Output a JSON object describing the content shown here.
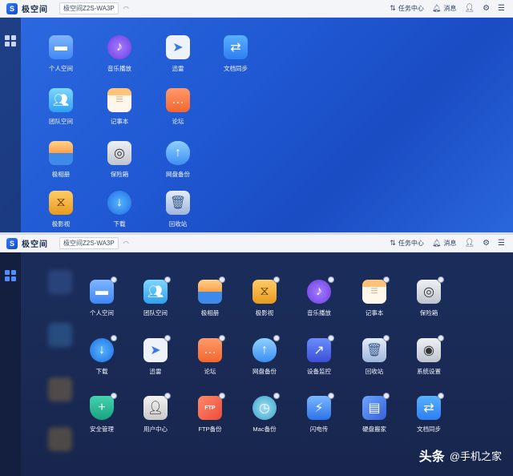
{
  "titlebar": {
    "logo_text": "极空间",
    "device_name": "极空间Z2S-WA3P",
    "tasks_label": "任务中心",
    "messages_label": "消息"
  },
  "screen_top": {
    "apps": [
      {
        "label": "个人空间",
        "icon": "folder-icon"
      },
      {
        "label": "音乐播放",
        "icon": "music-icon"
      },
      {
        "label": "迅雷",
        "icon": "xunlei-bird-icon"
      },
      {
        "label": "文档同步",
        "icon": "sync-document-icon"
      },
      {
        "label": "团队空间",
        "icon": "team-folder-icon"
      },
      {
        "label": "记事本",
        "icon": "notepad-icon"
      },
      {
        "label": "论坛",
        "icon": "forum-chat-icon"
      },
      {
        "label": "极相册",
        "icon": "photo-album-icon"
      },
      {
        "label": "保险箱",
        "icon": "safe-box-icon"
      },
      {
        "label": "网盘备份",
        "icon": "cloud-backup-icon"
      },
      {
        "label": "极影视",
        "icon": "video-icon"
      },
      {
        "label": "下载",
        "icon": "download-globe-icon"
      },
      {
        "label": "回收站",
        "icon": "trash-icon"
      }
    ]
  },
  "screen_bottom": {
    "apps": [
      {
        "label": "个人空间",
        "icon": "folder-icon"
      },
      {
        "label": "团队空间",
        "icon": "team-folder-icon"
      },
      {
        "label": "极相册",
        "icon": "photo-album-icon"
      },
      {
        "label": "极影视",
        "icon": "video-icon"
      },
      {
        "label": "音乐播放",
        "icon": "music-icon"
      },
      {
        "label": "记事本",
        "icon": "notepad-icon"
      },
      {
        "label": "保险箱",
        "icon": "safe-box-icon"
      },
      {
        "label": "下载",
        "icon": "download-globe-icon"
      },
      {
        "label": "迅雷",
        "icon": "xunlei-bird-icon"
      },
      {
        "label": "论坛",
        "icon": "forum-chat-icon"
      },
      {
        "label": "网盘备份",
        "icon": "cloud-backup-icon"
      },
      {
        "label": "设备监控",
        "icon": "device-monitor-icon"
      },
      {
        "label": "回收站",
        "icon": "trash-icon"
      },
      {
        "label": "系统设置",
        "icon": "settings-icon"
      },
      {
        "label": "安全管理",
        "icon": "shield-icon"
      },
      {
        "label": "用户中心",
        "icon": "user-center-icon"
      },
      {
        "label": "FTP备份",
        "icon": "ftp-icon"
      },
      {
        "label": "Mac备份",
        "icon": "time-machine-icon"
      },
      {
        "label": "闪电传",
        "icon": "lightning-transfer-icon"
      },
      {
        "label": "硬盘搬家",
        "icon": "disk-move-icon"
      },
      {
        "label": "文档同步",
        "icon": "sync-document-icon"
      }
    ]
  },
  "watermark": {
    "brand": "头条",
    "handle": "@手机之家"
  }
}
